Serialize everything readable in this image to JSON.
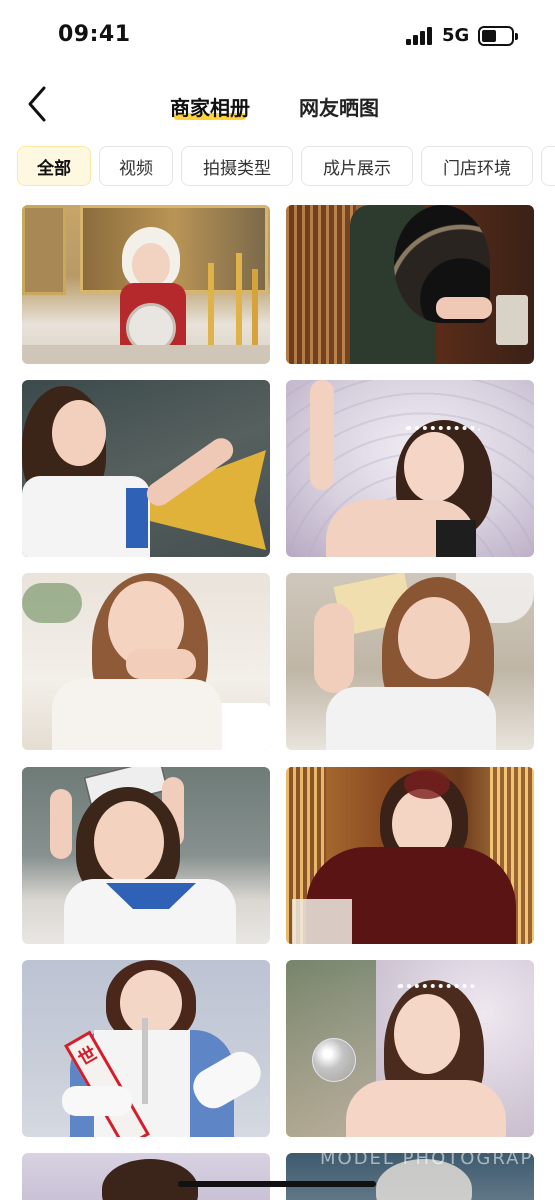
{
  "status_bar": {
    "time": "09:41",
    "network": "5G",
    "signal_icon": "signal-bars-icon",
    "battery_icon": "battery-icon"
  },
  "header": {
    "back_icon": "chevron-left-icon",
    "tabs": [
      {
        "label": "商家相册",
        "active": true
      },
      {
        "label": "网友晒图",
        "active": false
      }
    ],
    "accent_color": "#ffd43b"
  },
  "categories": {
    "items": [
      "全部",
      "视频",
      "拍摄类型",
      "成片展示",
      "门店环境"
    ],
    "selected": "全部"
  },
  "gallery": {
    "photos": [
      {
        "description_icon": "photo-thumbnail"
      },
      {
        "description_icon": "photo-thumbnail"
      },
      {
        "description_icon": "photo-thumbnail"
      },
      {
        "description_icon": "photo-thumbnail"
      },
      {
        "description_icon": "photo-thumbnail"
      },
      {
        "description_icon": "photo-thumbnail"
      },
      {
        "description_icon": "photo-thumbnail"
      },
      {
        "description_icon": "photo-thumbnail"
      },
      {
        "description_icon": "photo-thumbnail"
      },
      {
        "description_icon": "photo-thumbnail"
      },
      {
        "description_icon": "photo-thumbnail"
      },
      {
        "description_icon": "photo-thumbnail"
      }
    ],
    "sash_text": "世",
    "watermark": "MODEL PHOTOGRAPH"
  }
}
